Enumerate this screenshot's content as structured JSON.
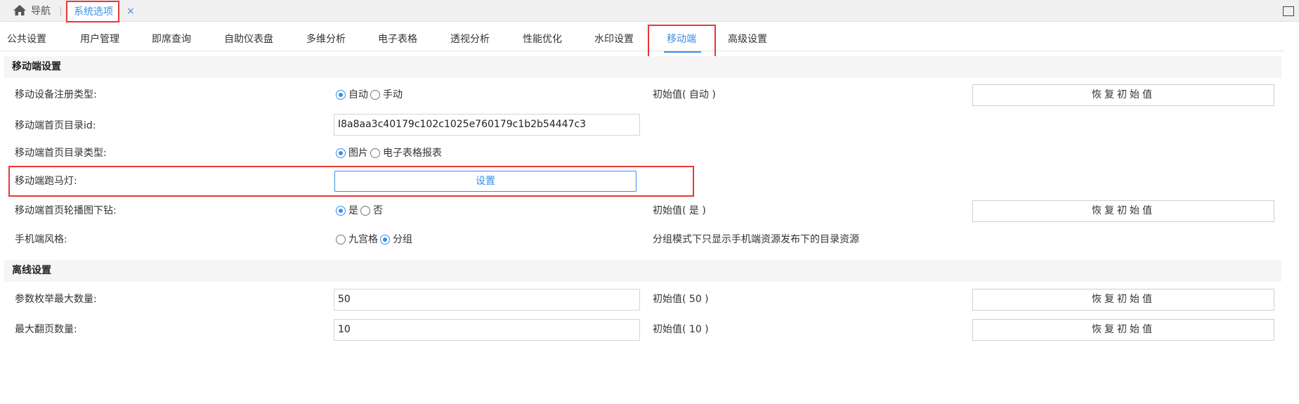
{
  "topbar": {
    "home_label": "导航",
    "active_tab_label": "系统选项",
    "close_symbol": "×"
  },
  "subtabs": [
    {
      "label": "公共设置"
    },
    {
      "label": "用户管理"
    },
    {
      "label": "即席查询"
    },
    {
      "label": "自助仪表盘"
    },
    {
      "label": "多维分析"
    },
    {
      "label": "电子表格"
    },
    {
      "label": "透视分析"
    },
    {
      "label": "性能优化"
    },
    {
      "label": "水印设置"
    },
    {
      "label": "移动端",
      "active": true
    },
    {
      "label": "高级设置"
    }
  ],
  "sections": {
    "mobile": {
      "title": "移动端设置",
      "rows": {
        "reg_type": {
          "label": "移动设备注册类型:",
          "options": [
            "自动",
            "手动"
          ],
          "selected": "自动",
          "initial": "初始值( 自动 )",
          "reset": "恢复初始值"
        },
        "home_dir_id": {
          "label": "移动端首页目录id:",
          "value": "I8a8aa3c40179c102c1025e760179c1b2b54447c3"
        },
        "home_dir_type": {
          "label": "移动端首页目录类型:",
          "options": [
            "图片",
            "电子表格报表"
          ],
          "selected": "图片"
        },
        "marquee": {
          "label": "移动端跑马灯:",
          "button": "设置"
        },
        "carousel_drill": {
          "label": "移动端首页轮播图下钻:",
          "options": [
            "是",
            "否"
          ],
          "selected": "是",
          "initial": "初始值( 是 )",
          "reset": "恢复初始值"
        },
        "phone_style": {
          "label": "手机端风格:",
          "options": [
            "九宫格",
            "分组"
          ],
          "selected": "分组",
          "note": "分组模式下只显示手机端资源发布下的目录资源"
        }
      }
    },
    "offline": {
      "title": "离线设置",
      "rows": {
        "enum_max": {
          "label": "参数枚举最大数量:",
          "value": "50",
          "initial": "初始值( 50 )",
          "reset": "恢复初始值"
        },
        "page_max": {
          "label": "最大翻页数量:",
          "value": "10",
          "initial": "初始值( 10 )",
          "reset": "恢复初始值"
        }
      }
    }
  },
  "colors": {
    "accent": "#3a8ee6",
    "highlight": "#e53935",
    "section_bg": "#f5f5f5"
  }
}
